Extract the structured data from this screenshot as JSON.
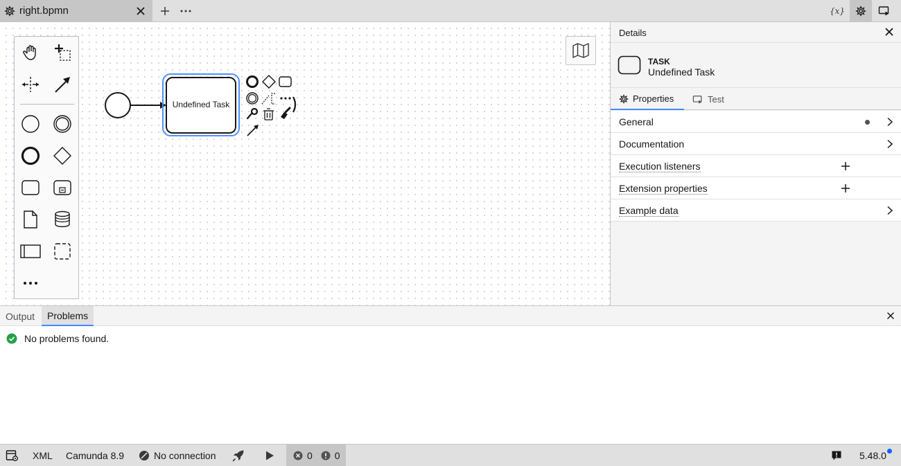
{
  "tab": {
    "title": "right.bpmn"
  },
  "top_actions": {
    "variables_label": "{x}"
  },
  "diagram": {
    "task_label": "Undefined Task"
  },
  "details": {
    "title": "Details",
    "element_type": "TASK",
    "element_name": "Undefined Task",
    "tabs": {
      "properties": "Properties",
      "test": "Test"
    },
    "groups": {
      "general": "General",
      "documentation": "Documentation",
      "execution_listeners": "Execution listeners",
      "extension_properties": "Extension properties",
      "example_data": "Example data"
    }
  },
  "log": {
    "tabs": {
      "output": "Output",
      "problems": "Problems"
    },
    "message": "No problems found."
  },
  "statusbar": {
    "xml": "XML",
    "engine": "Camunda 8.9",
    "connection": "No connection",
    "errors": "0",
    "warnings": "0",
    "version": "5.48.0"
  },
  "colors": {
    "selection": "#4d90fe",
    "success": "#24a148",
    "tab_active_underline": "#4589ff"
  }
}
